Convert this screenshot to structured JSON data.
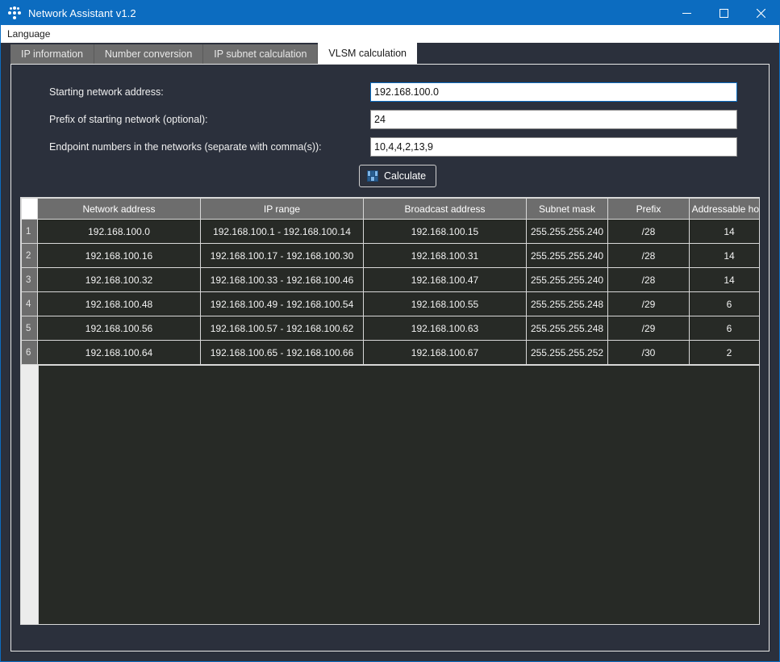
{
  "window": {
    "title": "Network Assistant v1.2",
    "icon": "network-nodes-icon",
    "accent_color": "#0c6cc0",
    "background_color": "#2b303c",
    "controls": {
      "minimize": "minimize-icon",
      "maximize": "maximize-icon",
      "close": "close-icon"
    }
  },
  "menubar": {
    "items": [
      {
        "label": "Language"
      }
    ]
  },
  "tabs": [
    {
      "label": "IP information",
      "active": false
    },
    {
      "label": "Number conversion",
      "active": false
    },
    {
      "label": "IP subnet calculation",
      "active": false
    },
    {
      "label": "VLSM calculation",
      "active": true
    }
  ],
  "form": {
    "fields": [
      {
        "label": "Starting network address:",
        "value": "192.168.100.0",
        "placeholder": "",
        "focused": true
      },
      {
        "label": "Prefix of starting network (optional):",
        "value": "24",
        "placeholder": "",
        "focused": false
      },
      {
        "label": "Endpoint numbers in the networks (separate with comma(s)):",
        "value": "10,4,4,2,13,9",
        "placeholder": "",
        "focused": false
      }
    ],
    "calculate_button": {
      "label": "Calculate",
      "icon": "binary-icon"
    }
  },
  "results_table": {
    "columns": [
      "",
      "Network address",
      "IP range",
      "Broadcast address",
      "Subnet mask",
      "Prefix",
      "Addressable host"
    ],
    "rows": [
      {
        "num": "1",
        "network": "192.168.100.0",
        "range": "192.168.100.1 - 192.168.100.14",
        "broadcast": "192.168.100.15",
        "mask": "255.255.255.240",
        "prefix": "/28",
        "hosts": "14"
      },
      {
        "num": "2",
        "network": "192.168.100.16",
        "range": "192.168.100.17 - 192.168.100.30",
        "broadcast": "192.168.100.31",
        "mask": "255.255.255.240",
        "prefix": "/28",
        "hosts": "14"
      },
      {
        "num": "3",
        "network": "192.168.100.32",
        "range": "192.168.100.33 - 192.168.100.46",
        "broadcast": "192.168.100.47",
        "mask": "255.255.255.240",
        "prefix": "/28",
        "hosts": "14"
      },
      {
        "num": "4",
        "network": "192.168.100.48",
        "range": "192.168.100.49 - 192.168.100.54",
        "broadcast": "192.168.100.55",
        "mask": "255.255.255.248",
        "prefix": "/29",
        "hosts": "6"
      },
      {
        "num": "5",
        "network": "192.168.100.56",
        "range": "192.168.100.57 - 192.168.100.62",
        "broadcast": "192.168.100.63",
        "mask": "255.255.255.248",
        "prefix": "/29",
        "hosts": "6"
      },
      {
        "num": "6",
        "network": "192.168.100.64",
        "range": "192.168.100.65 - 192.168.100.66",
        "broadcast": "192.168.100.67",
        "mask": "255.255.255.252",
        "prefix": "/30",
        "hosts": "2"
      }
    ]
  }
}
